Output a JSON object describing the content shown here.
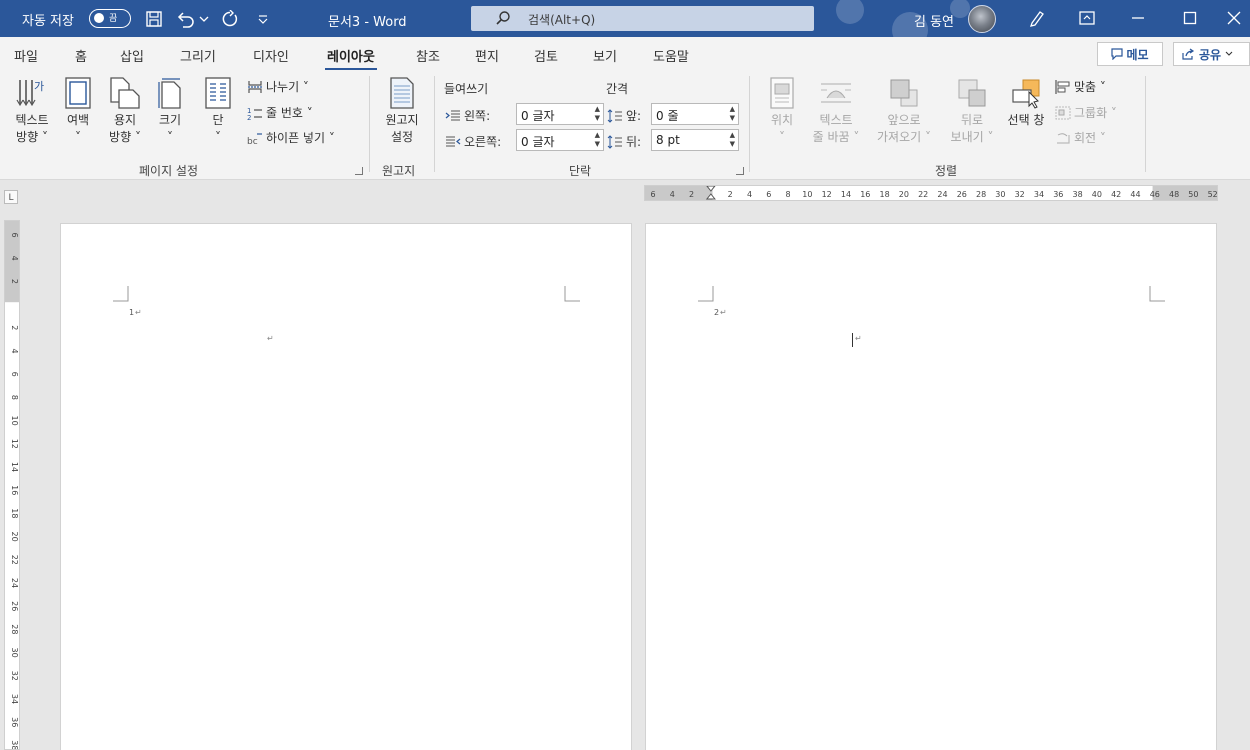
{
  "titlebar": {
    "autosave_label": "자동 저장",
    "autosave_state": "끔",
    "doc_title": "문서3  -  Word",
    "search_placeholder": "검색(Alt+Q)",
    "user_name": "김 동연",
    "accent_color": "#2b579a"
  },
  "tabs": [
    {
      "label": "파일"
    },
    {
      "label": "홈"
    },
    {
      "label": "삽입"
    },
    {
      "label": "그리기"
    },
    {
      "label": "디자인"
    },
    {
      "label": "레이아웃",
      "active": true
    },
    {
      "label": "참조"
    },
    {
      "label": "편지"
    },
    {
      "label": "검토"
    },
    {
      "label": "보기"
    },
    {
      "label": "도움말"
    }
  ],
  "actions": {
    "memo": "메모",
    "share": "공유"
  },
  "page_setup": {
    "text_direction": [
      "텍스트",
      "방향 ˅"
    ],
    "margins": [
      "여백",
      "˅"
    ],
    "orientation": [
      "용지",
      "방향 ˅"
    ],
    "size": [
      "크기",
      "˅"
    ],
    "columns": [
      "단",
      "˅"
    ],
    "breaks": "나누기 ˅",
    "line_numbers": "줄 번호 ˅",
    "hyphenation": "하이픈 넣기 ˅",
    "group_label": "페이지 설정"
  },
  "manuscript": {
    "button": [
      "원고지",
      "설정"
    ],
    "group_label": "원고지"
  },
  "paragraph": {
    "indent_header": "들여쓰기",
    "spacing_header": "간격",
    "left_label": "왼쪽:",
    "left_value": "0 글자",
    "right_label": "오른쪽:",
    "right_value": "0 글자",
    "before_label": "앞:",
    "before_value": "0 줄",
    "after_label": "뒤:",
    "after_value": "8 pt",
    "group_label": "단락"
  },
  "arrange": {
    "position": [
      "위치",
      "˅"
    ],
    "wrap_text": [
      "텍스트",
      "줄 바꿈 ˅"
    ],
    "bring_forward": [
      "앞으로",
      "가져오기 ˅"
    ],
    "send_backward": [
      "뒤로",
      "보내기 ˅"
    ],
    "selection_pane": "선택 창",
    "align": "맞춤 ˅",
    "group": "그룹화 ˅",
    "rotate": "회전 ˅",
    "group_label": "정렬"
  },
  "ruler": {
    "h_ticks": [
      "6",
      "4",
      "2",
      "",
      "2",
      "4",
      "6",
      "8",
      "10",
      "12",
      "14",
      "16",
      "18",
      "20",
      "22",
      "24",
      "26",
      "28",
      "30",
      "32",
      "34",
      "36",
      "38",
      "40",
      "42",
      "44",
      "46",
      "48",
      "50",
      "52"
    ],
    "v_ticks": [
      "6",
      "4",
      "2",
      "",
      "2",
      "4",
      "6",
      "8",
      "10",
      "12",
      "14",
      "16",
      "18",
      "20",
      "22",
      "24",
      "26",
      "28",
      "30",
      "32",
      "34",
      "36",
      "38"
    ],
    "corner": "L"
  },
  "pages": [
    {
      "number": "1"
    },
    {
      "number": "2"
    }
  ],
  "paragraph_mark": "↵"
}
